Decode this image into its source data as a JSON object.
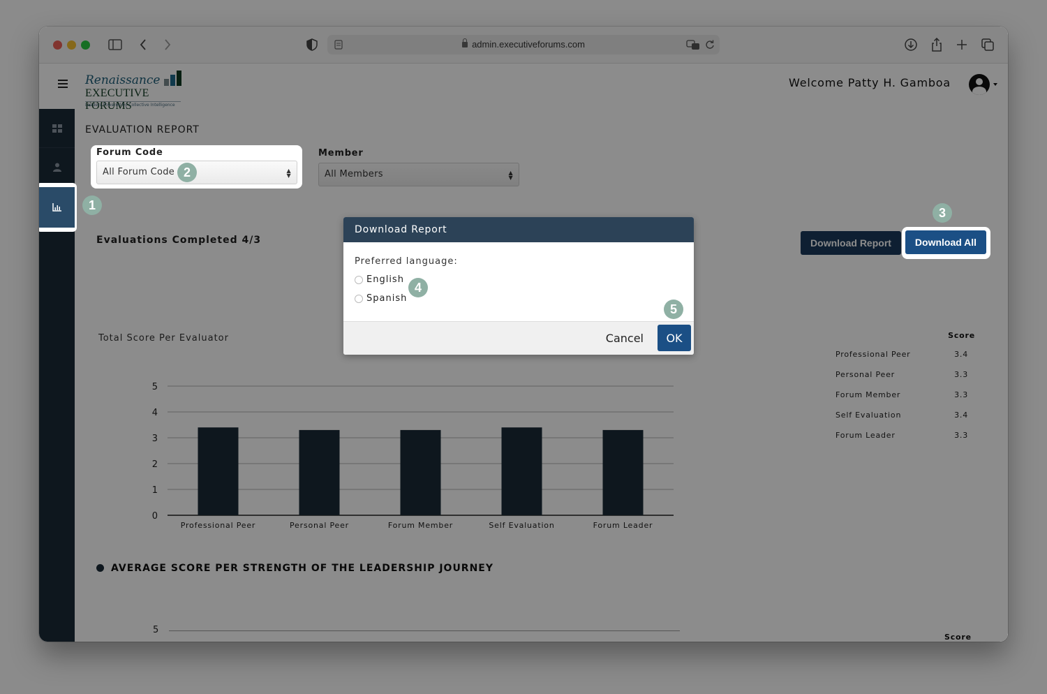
{
  "browser": {
    "url": "admin.executiveforums.com",
    "toolbar_icons": [
      "sidebar-icon",
      "back-icon",
      "forward-icon",
      "shield-icon",
      "reader-icon",
      "translate-icon",
      "reload-icon",
      "download-icon",
      "share-icon",
      "new-tab-icon",
      "tabs-icon"
    ]
  },
  "header": {
    "logo": {
      "line1": "Renaissance",
      "line2": "EXECUTIVE FORUMS",
      "tagline": "Leaders Powered by Collective Intelligence"
    },
    "welcome": "Welcome Patty H. Gamboa"
  },
  "sidebar": {
    "items": [
      {
        "name": "dashboard",
        "icon": "grid-icon",
        "active": false
      },
      {
        "name": "users",
        "icon": "user-icon",
        "active": false
      },
      {
        "name": "reports",
        "icon": "bar-chart-icon",
        "active": true
      }
    ]
  },
  "main": {
    "title": "EVALUATION REPORT",
    "filters": {
      "forum_code": {
        "label": "Forum Code",
        "value": "All Forum Code"
      },
      "member": {
        "label": "Member",
        "value": "All Members"
      }
    },
    "evaluations_completed": "Evaluations Completed 4/3",
    "buttons": {
      "download_report": "Download Report",
      "download_all": "Download All"
    },
    "section1": {
      "title": "Total Score Per Evaluator",
      "score_header": "Score",
      "rows": [
        {
          "label": "Professional Peer",
          "value": "3.4"
        },
        {
          "label": "Personal Peer",
          "value": "3.3"
        },
        {
          "label": "Forum Member",
          "value": "3.3"
        },
        {
          "label": "Self Evaluation",
          "value": "3.4"
        },
        {
          "label": "Forum Leader",
          "value": "3.3"
        }
      ]
    },
    "section2": {
      "title": "AVERAGE SCORE PER STRENGTH OF THE LEADERSHIP JOURNEY",
      "y_top_tick": "5",
      "score_header": "Score"
    }
  },
  "chart_data": {
    "type": "bar",
    "title": "Total Score Per Evaluator",
    "categories": [
      "Professional Peer",
      "Personal Peer",
      "Forum Member",
      "Self Evaluation",
      "Forum Leader"
    ],
    "values": [
      3.4,
      3.3,
      3.3,
      3.4,
      3.3
    ],
    "xlabel": "",
    "ylabel": "",
    "ylim": [
      0,
      5
    ],
    "yticks": [
      0,
      1,
      2,
      3,
      4,
      5
    ],
    "grid": true,
    "bar_color": "#1b2a38"
  },
  "modal": {
    "title": "Download Report",
    "question": "Preferred language:",
    "options": [
      {
        "label": "English",
        "checked": false
      },
      {
        "label": "Spanish",
        "checked": false
      }
    ],
    "cancel": "Cancel",
    "ok": "OK"
  },
  "annotations": {
    "badges": [
      "1",
      "2",
      "3",
      "4",
      "5"
    ]
  }
}
